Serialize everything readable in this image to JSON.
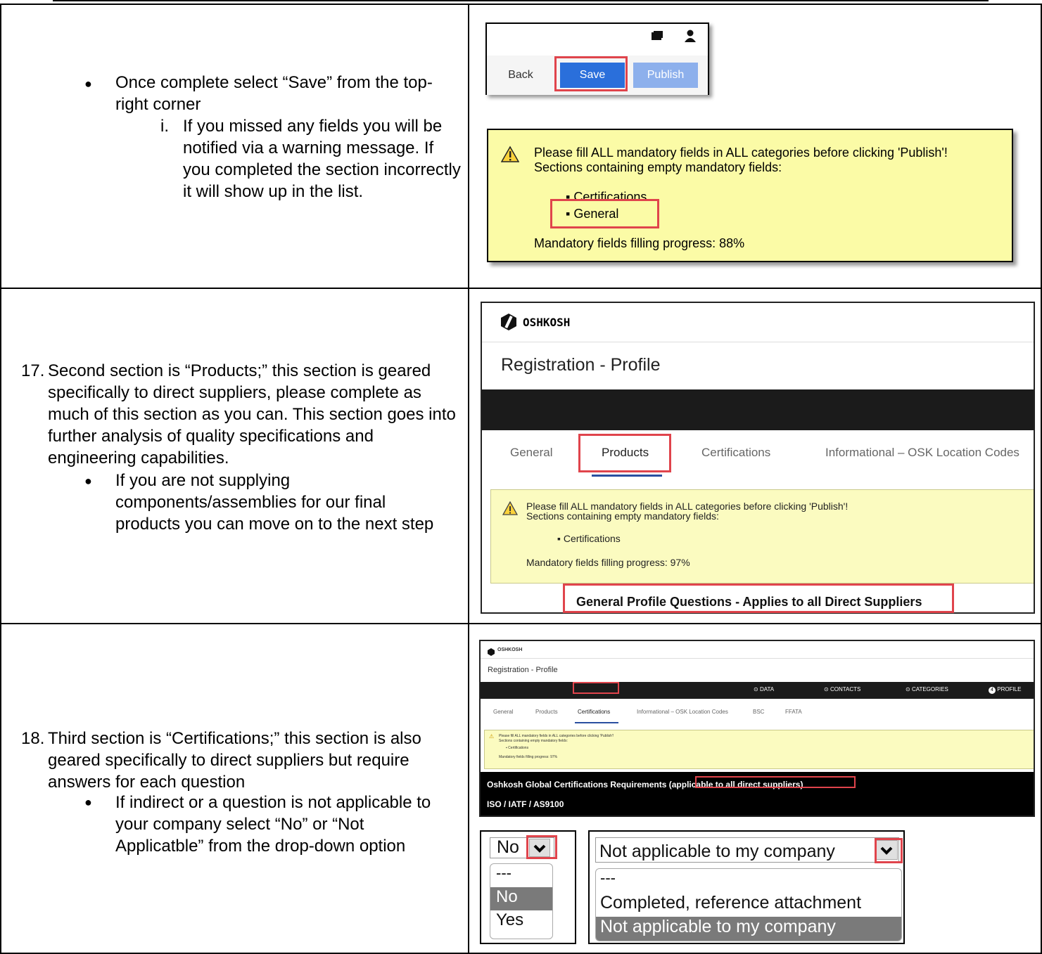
{
  "row1": {
    "bullet": "Once complete select “Save” from the top-right corner",
    "sub_marker": "i.",
    "sub_text": "If you missed any fields you will be notified via a warning message. If you completed the section incorrectly it will show up in the list.",
    "toolbar": {
      "back": "Back",
      "save": "Save",
      "publish": "Publish"
    },
    "warning": {
      "line1": "Please fill ALL mandatory fields in ALL categories before clicking 'Publish'!",
      "line2": "Sections containing empty mandatory fields:",
      "item1": "Certifications",
      "item2": "General",
      "progress": "Mandatory fields filling progress: 88%"
    }
  },
  "row2": {
    "number": "17.",
    "text": "Second section is “Products;” this section is geared specifically to direct suppliers, please complete as much of this section as you can. This section goes into further analysis of quality specifications and engineering capabilities.",
    "bullet": "If you are not supplying components/assemblies for our final products you can move on to the next step",
    "screenshot": {
      "brand": "OSHKOSH",
      "title": "Registration - Profile",
      "tabs": [
        "General",
        "Products",
        "Certifications",
        "Informational – OSK Location Codes"
      ],
      "warning_line1": "Please fill ALL mandatory fields in ALL categories before clicking 'Publish'!",
      "warning_line2": "Sections containing empty mandatory fields:",
      "warning_item": "Certifications",
      "progress": "Mandatory fields filling progress: 97%",
      "section_heading": "General Profile Questions - Applies to all Direct Suppliers"
    }
  },
  "row3": {
    "number": "18.",
    "text": "Third section is “Certifications;” this section is also geared specifically to direct suppliers but require answers for each question",
    "bullet": "If indirect or a question is not applicable to your company select “No” or “Not Applicatble” from the drop-down option",
    "screenshot": {
      "brand": "OSHKOSH",
      "title": "Registration - Profile",
      "steps": [
        "DATA",
        "CONTACTS",
        "CATEGORIES",
        "PROFILE"
      ],
      "step_number": "4",
      "tabs": [
        "General",
        "Products",
        "Certifications",
        "Informational – OSK Location Codes",
        "BSC",
        "FFATA"
      ],
      "warning_line1": "Please fill ALL mandatory fields in ALL categories before clicking 'Publish'!",
      "warning_line2": "Sections containing empty mandatory fields:",
      "warning_item": "Certifications",
      "progress": "Mandatory fields filling progress: 97%",
      "heading": "Oshkosh Global Certifications Requirements",
      "heading_note": "(applicable to all direct suppliers)",
      "subheading": "ISO / IATF / AS9100"
    },
    "dropdown1": {
      "selected": "No",
      "options": [
        "---",
        "No",
        "Yes"
      ]
    },
    "dropdown2": {
      "selected": "Not applicable to my company",
      "options": [
        "---",
        "Completed, reference attachment",
        "Not applicable to my company"
      ]
    }
  }
}
